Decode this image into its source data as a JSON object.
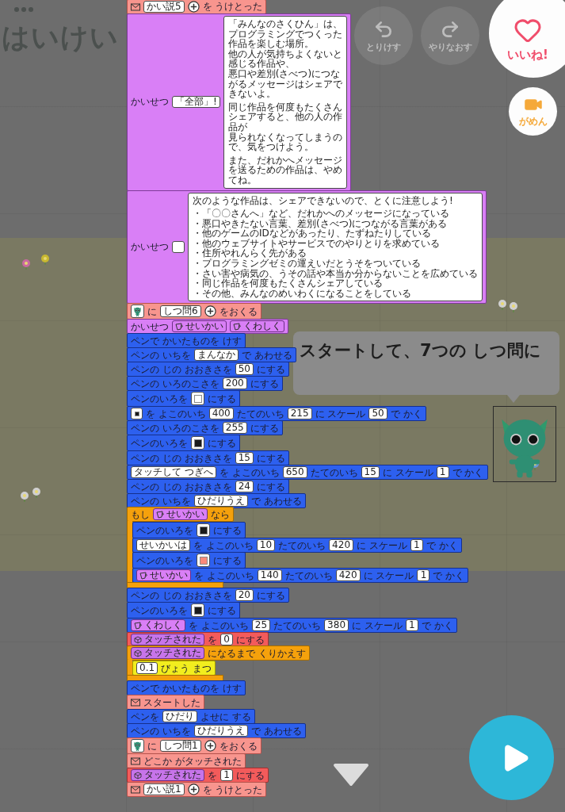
{
  "stage": {
    "background_title": "はいけい",
    "bubble": "スタートして、7つの しつ問に"
  },
  "toolbar": {
    "undo": {
      "label": "とりけす",
      "disabled": true
    },
    "redo": {
      "label": "やりなおす",
      "disabled": true
    },
    "like": {
      "label": "いいね!"
    },
    "screen": {
      "label": "がめん"
    }
  },
  "script": [
    {
      "kind": "event",
      "parts": [
        {
          "kind": "mail"
        },
        {
          "kind": "field",
          "text": "かい説5"
        },
        {
          "kind": "plus"
        },
        {
          "kind": "label",
          "text": "を うけとった"
        }
      ]
    },
    {
      "kind": "explain",
      "parts": [
        {
          "kind": "label",
          "text": "かいせつ"
        },
        {
          "kind": "field",
          "text": "「全部」!"
        },
        {
          "kind": "note",
          "paragraphs": [
            [
              "「みんなのさくひん」は、プログラミングでつくった作品を楽しむ場所。",
              "他の人が気持ちよくないと感じる作品や、",
              "悪口や差別(さべつ)につながるメッセージはシェアできないよ。"
            ],
            [
              "同じ作品を何度もたくさんシェアすると、他の人の作品が",
              "見られなくなってしまうので、気をつけよう。"
            ],
            [
              "また、だれかへメッセージを送るための作品は、やめてね。"
            ]
          ]
        }
      ]
    },
    {
      "kind": "explain",
      "parts": [
        {
          "kind": "label",
          "text": "かいせつ"
        },
        {
          "kind": "field"
        },
        {
          "kind": "note",
          "paragraphs": [
            [
              "次のような作品は、シェアできないので、とくに注意しよう!"
            ],
            [
              "・「〇〇さんへ」など、だれかへのメッセージになっている",
              "・悪口やきたない言葉、差別(さべつ)につながる言葉がある",
              "・他のゲームのIDなどがあったり、たずねたりしている",
              "・他のウェブサイトやサービスでのやりとりを求めている",
              "・住所やれんらく先がある",
              "・プログラミングゼミの運えいだとうそをついている",
              "・さい害や病気の、うその話や本当か分からないことを広めている",
              "・同じ作品を何度もたくさんシェアしている",
              "・その他、みんなのめいわくになることをしている"
            ]
          ]
        }
      ]
    },
    {
      "kind": "message",
      "parts": [
        {
          "kind": "sprite"
        },
        {
          "kind": "label",
          "text": "に"
        },
        {
          "kind": "field",
          "text": "しつ問6"
        },
        {
          "kind": "plus"
        },
        {
          "kind": "label",
          "text": "をおくる"
        }
      ]
    },
    {
      "kind": "explain",
      "parts": [
        {
          "kind": "label",
          "text": "かいせつ"
        },
        {
          "kind": "tag",
          "text": "せいかい"
        },
        {
          "kind": "tag",
          "text": "くわしく"
        }
      ]
    },
    {
      "kind": "pen",
      "parts": [
        {
          "kind": "label",
          "text": "ペンで かいたものを けす"
        }
      ]
    },
    {
      "kind": "pen",
      "parts": [
        {
          "kind": "label",
          "text": "ペンの いちを"
        },
        {
          "kind": "field",
          "text": "まんなか"
        },
        {
          "kind": "label",
          "text": "で あわせる"
        }
      ]
    },
    {
      "kind": "pen",
      "parts": [
        {
          "kind": "label",
          "text": "ペンの じの おおきさを"
        },
        {
          "kind": "field",
          "text": "50"
        },
        {
          "kind": "label",
          "text": "にする"
        }
      ]
    },
    {
      "kind": "pen",
      "parts": [
        {
          "kind": "label",
          "text": "ペンの いろのこさを"
        },
        {
          "kind": "field",
          "text": "200"
        },
        {
          "kind": "label",
          "text": "にする"
        }
      ]
    },
    {
      "kind": "pen",
      "parts": [
        {
          "kind": "label",
          "text": "ペンのいろを"
        },
        {
          "kind": "swatch",
          "color": "#ffffff"
        },
        {
          "kind": "label",
          "text": "にする"
        }
      ]
    },
    {
      "kind": "pen",
      "parts": [
        {
          "kind": "mini",
          "color": "#1b1b1b"
        },
        {
          "kind": "label",
          "text": "を よこのいち"
        },
        {
          "kind": "field",
          "text": "400"
        },
        {
          "kind": "label",
          "text": "たてのいち"
        },
        {
          "kind": "field",
          "text": "215"
        },
        {
          "kind": "label",
          "text": "に スケール"
        },
        {
          "kind": "field",
          "text": "50"
        },
        {
          "kind": "label",
          "text": "で かく"
        }
      ]
    },
    {
      "kind": "pen",
      "parts": [
        {
          "kind": "label",
          "text": "ペンの いろのこさを"
        },
        {
          "kind": "field",
          "text": "255"
        },
        {
          "kind": "label",
          "text": "にする"
        }
      ]
    },
    {
      "kind": "pen",
      "parts": [
        {
          "kind": "label",
          "text": "ペンのいろを"
        },
        {
          "kind": "swatch",
          "color": "#1b1b1b"
        },
        {
          "kind": "label",
          "text": "にする"
        }
      ]
    },
    {
      "kind": "pen",
      "parts": [
        {
          "kind": "label",
          "text": "ペンの じの おおきさを"
        },
        {
          "kind": "field",
          "text": "15"
        },
        {
          "kind": "label",
          "text": "にする"
        }
      ]
    },
    {
      "kind": "pen",
      "parts": [
        {
          "kind": "field",
          "text": "タッチして つぎへ"
        },
        {
          "kind": "label",
          "text": "を よこのいち"
        },
        {
          "kind": "field",
          "text": "650"
        },
        {
          "kind": "label",
          "text": "たてのいち"
        },
        {
          "kind": "field",
          "text": "15"
        },
        {
          "kind": "label",
          "text": "に スケール"
        },
        {
          "kind": "field",
          "text": "1"
        },
        {
          "kind": "label",
          "text": "で かく"
        }
      ]
    },
    {
      "kind": "pen",
      "parts": [
        {
          "kind": "label",
          "text": "ペンの じの おおきさを"
        },
        {
          "kind": "field",
          "text": "24"
        },
        {
          "kind": "label",
          "text": "にする"
        }
      ]
    },
    {
      "kind": "pen",
      "parts": [
        {
          "kind": "label",
          "text": "ペンの いちを"
        },
        {
          "kind": "field",
          "text": "ひだりうえ"
        },
        {
          "kind": "label",
          "text": "で あわせる"
        }
      ]
    },
    {
      "kind": "control",
      "parts": [
        {
          "kind": "label",
          "text": "もし"
        },
        {
          "kind": "tag",
          "text": "せいかい"
        },
        {
          "kind": "label",
          "text": "なら"
        }
      ],
      "children": [
        {
          "kind": "pen",
          "parts": [
            {
              "kind": "label",
              "text": "ペンのいろを"
            },
            {
              "kind": "swatch",
              "color": "#1b1b1b"
            },
            {
              "kind": "label",
              "text": "にする"
            }
          ]
        },
        {
          "kind": "pen",
          "parts": [
            {
              "kind": "field",
              "text": "せいかいは"
            },
            {
              "kind": "label",
              "text": "を よこのいち"
            },
            {
              "kind": "field",
              "text": "10"
            },
            {
              "kind": "label",
              "text": "たてのいち"
            },
            {
              "kind": "field",
              "text": "420"
            },
            {
              "kind": "label",
              "text": "に スケール"
            },
            {
              "kind": "field",
              "text": "1"
            },
            {
              "kind": "label",
              "text": "で かく"
            }
          ]
        },
        {
          "kind": "pen",
          "parts": [
            {
              "kind": "label",
              "text": "ペンのいろを"
            },
            {
              "kind": "swatch",
              "color": "#f98a7a"
            },
            {
              "kind": "label",
              "text": "にする"
            }
          ]
        },
        {
          "kind": "pen",
          "parts": [
            {
              "kind": "tag",
              "text": "せいかい"
            },
            {
              "kind": "label",
              "text": "を よこのいち"
            },
            {
              "kind": "field",
              "text": "140"
            },
            {
              "kind": "label",
              "text": "たてのいち"
            },
            {
              "kind": "field",
              "text": "420"
            },
            {
              "kind": "label",
              "text": "に スケール"
            },
            {
              "kind": "field",
              "text": "1"
            },
            {
              "kind": "label",
              "text": "で かく"
            }
          ]
        }
      ]
    },
    {
      "kind": "pen",
      "parts": [
        {
          "kind": "label",
          "text": "ペンの じの おおきさを"
        },
        {
          "kind": "field",
          "text": "20"
        },
        {
          "kind": "label",
          "text": "にする"
        }
      ]
    },
    {
      "kind": "pen",
      "parts": [
        {
          "kind": "label",
          "text": "ペンのいろを"
        },
        {
          "kind": "swatch",
          "color": "#1b1b1b"
        },
        {
          "kind": "label",
          "text": "にする"
        }
      ]
    },
    {
      "kind": "pen",
      "parts": [
        {
          "kind": "tag",
          "text": "くわしく"
        },
        {
          "kind": "label",
          "text": "を よこのいち"
        },
        {
          "kind": "field",
          "text": "25"
        },
        {
          "kind": "label",
          "text": "たてのいち"
        },
        {
          "kind": "field",
          "text": "380"
        },
        {
          "kind": "label",
          "text": "に スケール"
        },
        {
          "kind": "field",
          "text": "1"
        },
        {
          "kind": "label",
          "text": "で かく"
        }
      ]
    },
    {
      "kind": "variable",
      "parts": [
        {
          "kind": "var",
          "text": "タッチされた"
        },
        {
          "kind": "label",
          "text": "を"
        },
        {
          "kind": "field",
          "text": "0"
        },
        {
          "kind": "label",
          "text": "にする"
        }
      ]
    },
    {
      "kind": "control",
      "parts": [
        {
          "kind": "var",
          "text": "タッチされた"
        },
        {
          "kind": "label",
          "text": "になるまで くりかえす"
        }
      ],
      "children": [
        {
          "kind": "wait",
          "parts": [
            {
              "kind": "field",
              "text": "0.1"
            },
            {
              "kind": "label",
              "text": "びょう まつ"
            }
          ]
        }
      ]
    },
    {
      "kind": "pen",
      "parts": [
        {
          "kind": "label",
          "text": "ペンで かいたものを けす"
        }
      ]
    },
    {
      "kind": "event",
      "parts": [
        {
          "kind": "mail"
        },
        {
          "kind": "label",
          "text": "スタートした"
        }
      ]
    },
    {
      "kind": "pen",
      "parts": [
        {
          "kind": "label",
          "text": "ペンを"
        },
        {
          "kind": "field",
          "text": "ひだり"
        },
        {
          "kind": "label",
          "text": "よせに する"
        }
      ]
    },
    {
      "kind": "pen",
      "parts": [
        {
          "kind": "label",
          "text": "ペンの いちを"
        },
        {
          "kind": "field",
          "text": "ひだりうえ"
        },
        {
          "kind": "label",
          "text": "で あわせる"
        }
      ]
    },
    {
      "kind": "message",
      "parts": [
        {
          "kind": "sprite"
        },
        {
          "kind": "label",
          "text": "に"
        },
        {
          "kind": "field",
          "text": "しつ問1"
        },
        {
          "kind": "plus"
        },
        {
          "kind": "label",
          "text": "をおくる"
        }
      ]
    },
    {
      "kind": "event",
      "parts": [
        {
          "kind": "mail"
        },
        {
          "kind": "label",
          "text": "どこか がタッチされた"
        }
      ]
    },
    {
      "kind": "variable",
      "parts": [
        {
          "kind": "var",
          "text": "タッチされた"
        },
        {
          "kind": "label",
          "text": "を"
        },
        {
          "kind": "field",
          "text": "1"
        },
        {
          "kind": "label",
          "text": "にする"
        }
      ]
    },
    {
      "kind": "event",
      "parts": [
        {
          "kind": "mail"
        },
        {
          "kind": "field",
          "text": "かい説1"
        },
        {
          "kind": "plus"
        },
        {
          "kind": "label",
          "text": "を うけとった"
        }
      ]
    }
  ]
}
